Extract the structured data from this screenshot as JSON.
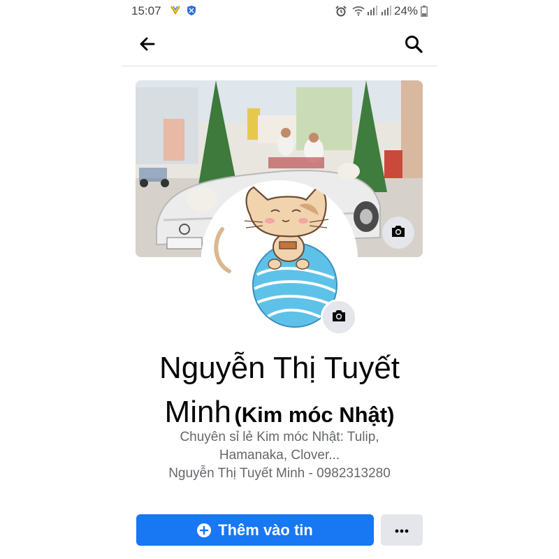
{
  "status_bar": {
    "time": "15:07",
    "notif_app_letter": "V",
    "battery": "24%",
    "icons": [
      "v-app-icon",
      "shield-icon",
      "alarm-icon",
      "wifi-icon",
      "signal-icon",
      "signal-icon",
      "battery-icon"
    ]
  },
  "header": {
    "back_icon": "arrow-left-icon",
    "search_icon": "search-icon"
  },
  "profile": {
    "name_main": "Nguyễn Thị Tuyết Minh",
    "name_alt": "(Kim móc Nhật)",
    "bio_lines": [
      "Chuyên sỉ lẻ Kim móc Nhật: Tulip,",
      "Hamanaka, Clover...",
      "Nguyễn Thị Tuyết Minh - 0982313280"
    ],
    "cover_camera_icon": "camera-icon",
    "avatar_camera_icon": "camera-icon"
  },
  "actions": {
    "add_story_label": "Thêm vào tin",
    "add_story_icon": "plus-circle-icon",
    "more_icon": "more-horizontal-icon"
  },
  "colors": {
    "primary": "#1877f2",
    "secondary_button": "#e4e6eb",
    "text_primary": "#050505",
    "text_secondary": "#65676b"
  }
}
